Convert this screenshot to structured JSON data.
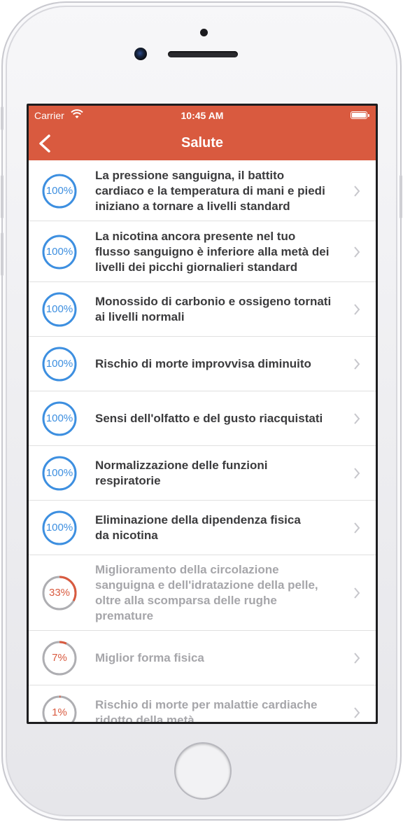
{
  "status_bar": {
    "carrier": "Carrier",
    "time": "10:45 AM"
  },
  "nav": {
    "title": "Salute",
    "back_icon": "chevron-left-icon"
  },
  "colors": {
    "nav_bg": "#d95a3f",
    "complete_ring": "#3d8fe0",
    "progress_ring": "#d95a3f",
    "track_ring": "#aeaeb2",
    "active_text": "#3b3b3d",
    "inactive_text": "#a6a6aa"
  },
  "items": [
    {
      "percent_label": "100%",
      "progress": 1.0,
      "text_lines": [
        "La pressione sanguigna, il battito",
        "cardiaco e la temperatura di mani e piedi",
        "iniziano a tornare a livelli standard"
      ]
    },
    {
      "percent_label": "100%",
      "progress": 1.0,
      "text_lines": [
        "La nicotina ancora presente nel tuo",
        "flusso sanguigno è inferiore alla metà dei",
        "livelli dei picchi giornalieri standard"
      ]
    },
    {
      "percent_label": "100%",
      "progress": 1.0,
      "text_lines": [
        "Monossido di carbonio e ossigeno tornati",
        "ai livelli normali"
      ]
    },
    {
      "percent_label": "100%",
      "progress": 1.0,
      "text_lines": [
        "Rischio di morte improvvisa diminuito"
      ]
    },
    {
      "percent_label": "100%",
      "progress": 1.0,
      "text_lines": [
        "Sensi dell'olfatto e del gusto riacquistati"
      ]
    },
    {
      "percent_label": "100%",
      "progress": 1.0,
      "text_lines": [
        "Normalizzazione delle funzioni",
        "respiratorie"
      ]
    },
    {
      "percent_label": "100%",
      "progress": 1.0,
      "text_lines": [
        "Eliminazione della dipendenza fisica",
        "da nicotina"
      ]
    },
    {
      "percent_label": "33%",
      "progress": 0.33,
      "text_lines": [
        "Miglioramento della circolazione",
        "sanguigna e dell'idratazione della pelle,",
        "oltre alla scomparsa delle rughe",
        "premature"
      ]
    },
    {
      "percent_label": "7%",
      "progress": 0.07,
      "text_lines": [
        "Miglior forma fisica"
      ]
    },
    {
      "percent_label": "1%",
      "progress": 0.01,
      "text_lines": [
        "Rischio di morte per malattie cardiache",
        "ridotto della metà"
      ]
    }
  ]
}
